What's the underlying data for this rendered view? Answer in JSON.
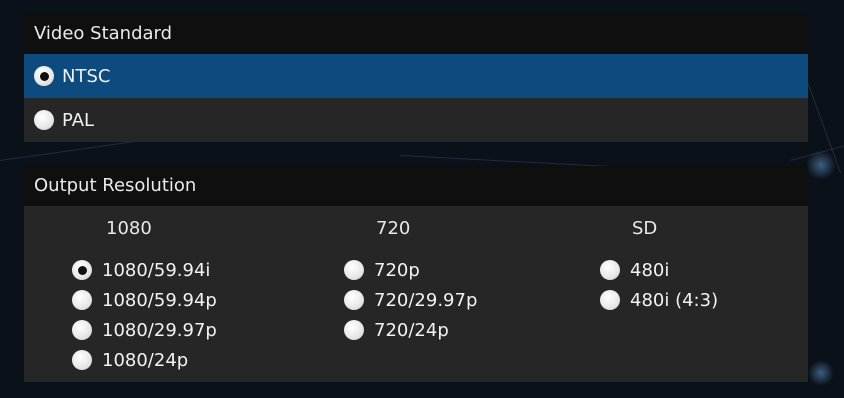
{
  "video_standard": {
    "title": "Video Standard",
    "options": [
      {
        "label": "NTSC",
        "selected": true
      },
      {
        "label": "PAL",
        "selected": false
      }
    ]
  },
  "output_resolution": {
    "title": "Output Resolution",
    "columns": [
      {
        "header": "1080",
        "items": [
          {
            "label": "1080/59.94i",
            "selected": true
          },
          {
            "label": "1080/59.94p",
            "selected": false
          },
          {
            "label": "1080/29.97p",
            "selected": false
          },
          {
            "label": "1080/24p",
            "selected": false
          }
        ]
      },
      {
        "header": "720",
        "items": [
          {
            "label": "720p",
            "selected": false
          },
          {
            "label": "720/29.97p",
            "selected": false
          },
          {
            "label": "720/24p",
            "selected": false
          }
        ]
      },
      {
        "header": "SD",
        "items": [
          {
            "label": "480i",
            "selected": false
          },
          {
            "label": "480i (4:3)",
            "selected": false
          }
        ]
      }
    ]
  },
  "colors": {
    "selected_row": "#0d4a7e",
    "panel": "#262626",
    "header": "#0f0f0f"
  }
}
